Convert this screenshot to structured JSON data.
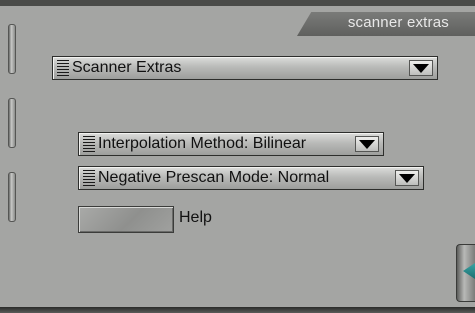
{
  "header": {
    "title": "scanner extras"
  },
  "panel_selector": {
    "label": "Scanner Extras"
  },
  "interpolation_method": {
    "label": "Interpolation Method: Bilinear"
  },
  "negative_prescan_mode": {
    "label": "Negative Prescan Mode: Normal"
  },
  "help": {
    "label": "Help"
  },
  "icons": {
    "grip": "grip-lines-icon",
    "dropdown": "triangle-down-icon",
    "collapse": "triangle-left-icon"
  },
  "colors": {
    "panel": "#a4a5a3",
    "header_tab": "#6b6c6a",
    "header_text": "#e8e8e8",
    "collapse_accent": "#2a8b8c"
  }
}
